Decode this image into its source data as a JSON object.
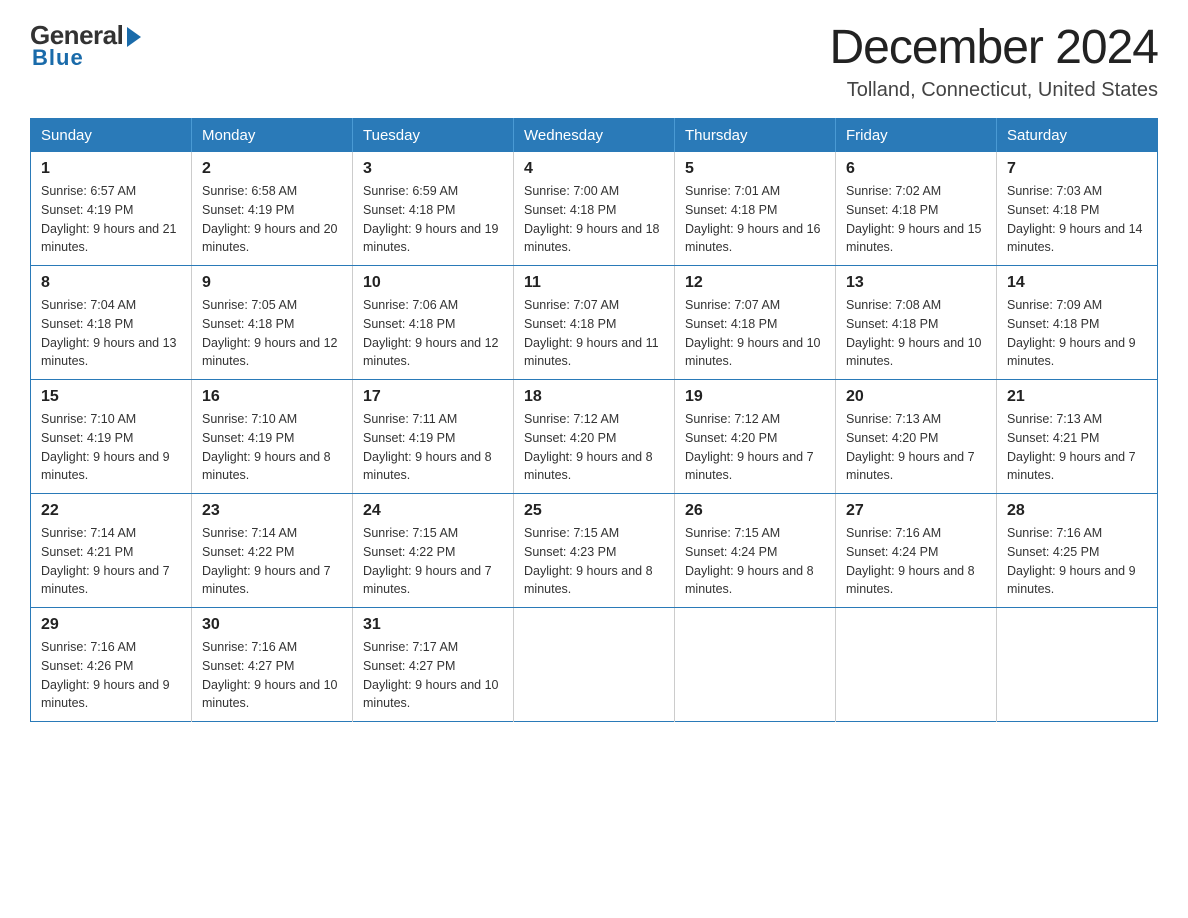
{
  "logo": {
    "general": "General",
    "blue": "Blue"
  },
  "title": "December 2024",
  "location": "Tolland, Connecticut, United States",
  "days_of_week": [
    "Sunday",
    "Monday",
    "Tuesday",
    "Wednesday",
    "Thursday",
    "Friday",
    "Saturday"
  ],
  "weeks": [
    [
      {
        "day": "1",
        "sunrise": "6:57 AM",
        "sunset": "4:19 PM",
        "daylight": "9 hours and 21 minutes."
      },
      {
        "day": "2",
        "sunrise": "6:58 AM",
        "sunset": "4:19 PM",
        "daylight": "9 hours and 20 minutes."
      },
      {
        "day": "3",
        "sunrise": "6:59 AM",
        "sunset": "4:18 PM",
        "daylight": "9 hours and 19 minutes."
      },
      {
        "day": "4",
        "sunrise": "7:00 AM",
        "sunset": "4:18 PM",
        "daylight": "9 hours and 18 minutes."
      },
      {
        "day": "5",
        "sunrise": "7:01 AM",
        "sunset": "4:18 PM",
        "daylight": "9 hours and 16 minutes."
      },
      {
        "day": "6",
        "sunrise": "7:02 AM",
        "sunset": "4:18 PM",
        "daylight": "9 hours and 15 minutes."
      },
      {
        "day": "7",
        "sunrise": "7:03 AM",
        "sunset": "4:18 PM",
        "daylight": "9 hours and 14 minutes."
      }
    ],
    [
      {
        "day": "8",
        "sunrise": "7:04 AM",
        "sunset": "4:18 PM",
        "daylight": "9 hours and 13 minutes."
      },
      {
        "day": "9",
        "sunrise": "7:05 AM",
        "sunset": "4:18 PM",
        "daylight": "9 hours and 12 minutes."
      },
      {
        "day": "10",
        "sunrise": "7:06 AM",
        "sunset": "4:18 PM",
        "daylight": "9 hours and 12 minutes."
      },
      {
        "day": "11",
        "sunrise": "7:07 AM",
        "sunset": "4:18 PM",
        "daylight": "9 hours and 11 minutes."
      },
      {
        "day": "12",
        "sunrise": "7:07 AM",
        "sunset": "4:18 PM",
        "daylight": "9 hours and 10 minutes."
      },
      {
        "day": "13",
        "sunrise": "7:08 AM",
        "sunset": "4:18 PM",
        "daylight": "9 hours and 10 minutes."
      },
      {
        "day": "14",
        "sunrise": "7:09 AM",
        "sunset": "4:18 PM",
        "daylight": "9 hours and 9 minutes."
      }
    ],
    [
      {
        "day": "15",
        "sunrise": "7:10 AM",
        "sunset": "4:19 PM",
        "daylight": "9 hours and 9 minutes."
      },
      {
        "day": "16",
        "sunrise": "7:10 AM",
        "sunset": "4:19 PM",
        "daylight": "9 hours and 8 minutes."
      },
      {
        "day": "17",
        "sunrise": "7:11 AM",
        "sunset": "4:19 PM",
        "daylight": "9 hours and 8 minutes."
      },
      {
        "day": "18",
        "sunrise": "7:12 AM",
        "sunset": "4:20 PM",
        "daylight": "9 hours and 8 minutes."
      },
      {
        "day": "19",
        "sunrise": "7:12 AM",
        "sunset": "4:20 PM",
        "daylight": "9 hours and 7 minutes."
      },
      {
        "day": "20",
        "sunrise": "7:13 AM",
        "sunset": "4:20 PM",
        "daylight": "9 hours and 7 minutes."
      },
      {
        "day": "21",
        "sunrise": "7:13 AM",
        "sunset": "4:21 PM",
        "daylight": "9 hours and 7 minutes."
      }
    ],
    [
      {
        "day": "22",
        "sunrise": "7:14 AM",
        "sunset": "4:21 PM",
        "daylight": "9 hours and 7 minutes."
      },
      {
        "day": "23",
        "sunrise": "7:14 AM",
        "sunset": "4:22 PM",
        "daylight": "9 hours and 7 minutes."
      },
      {
        "day": "24",
        "sunrise": "7:15 AM",
        "sunset": "4:22 PM",
        "daylight": "9 hours and 7 minutes."
      },
      {
        "day": "25",
        "sunrise": "7:15 AM",
        "sunset": "4:23 PM",
        "daylight": "9 hours and 8 minutes."
      },
      {
        "day": "26",
        "sunrise": "7:15 AM",
        "sunset": "4:24 PM",
        "daylight": "9 hours and 8 minutes."
      },
      {
        "day": "27",
        "sunrise": "7:16 AM",
        "sunset": "4:24 PM",
        "daylight": "9 hours and 8 minutes."
      },
      {
        "day": "28",
        "sunrise": "7:16 AM",
        "sunset": "4:25 PM",
        "daylight": "9 hours and 9 minutes."
      }
    ],
    [
      {
        "day": "29",
        "sunrise": "7:16 AM",
        "sunset": "4:26 PM",
        "daylight": "9 hours and 9 minutes."
      },
      {
        "day": "30",
        "sunrise": "7:16 AM",
        "sunset": "4:27 PM",
        "daylight": "9 hours and 10 minutes."
      },
      {
        "day": "31",
        "sunrise": "7:17 AM",
        "sunset": "4:27 PM",
        "daylight": "9 hours and 10 minutes."
      },
      null,
      null,
      null,
      null
    ]
  ]
}
